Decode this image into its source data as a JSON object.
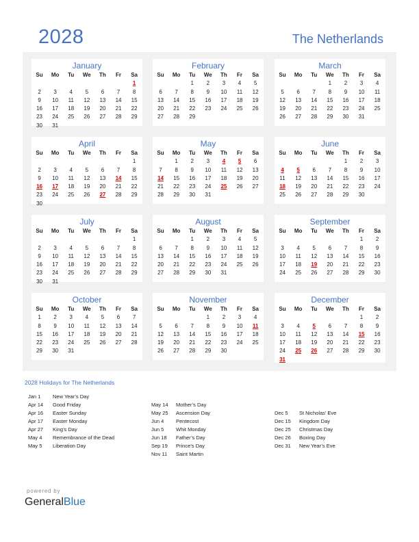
{
  "header": {
    "year": "2028",
    "country": "The Netherlands"
  },
  "weekdays": [
    "Su",
    "Mo",
    "Tu",
    "We",
    "Th",
    "Fr",
    "Sa"
  ],
  "months": [
    {
      "name": "January",
      "start": 6,
      "days": 31,
      "holidays": [
        1
      ]
    },
    {
      "name": "February",
      "start": 2,
      "days": 29,
      "holidays": []
    },
    {
      "name": "March",
      "start": 3,
      "days": 31,
      "holidays": []
    },
    {
      "name": "April",
      "start": 6,
      "days": 30,
      "holidays": [
        14,
        16,
        17,
        27
      ]
    },
    {
      "name": "May",
      "start": 1,
      "days": 31,
      "holidays": [
        4,
        5,
        14,
        25
      ]
    },
    {
      "name": "June",
      "start": 4,
      "days": 30,
      "holidays": [
        4,
        5,
        18
      ]
    },
    {
      "name": "July",
      "start": 6,
      "days": 31,
      "holidays": []
    },
    {
      "name": "August",
      "start": 2,
      "days": 31,
      "holidays": []
    },
    {
      "name": "September",
      "start": 5,
      "days": 30,
      "holidays": [
        19
      ]
    },
    {
      "name": "October",
      "start": 0,
      "days": 31,
      "holidays": []
    },
    {
      "name": "November",
      "start": 3,
      "days": 30,
      "holidays": [
        11
      ]
    },
    {
      "name": "December",
      "start": 5,
      "days": 31,
      "holidays": [
        5,
        15,
        25,
        26,
        31
      ]
    }
  ],
  "holidays_title": "2028 Holidays for The Netherlands",
  "holiday_columns": [
    [
      {
        "date": "Jan 1",
        "name": "New Year’s Day"
      },
      {
        "date": "Apr 14",
        "name": "Good Friday"
      },
      {
        "date": "Apr 16",
        "name": "Easter Sunday"
      },
      {
        "date": "Apr 17",
        "name": "Easter Monday"
      },
      {
        "date": "Apr 27",
        "name": "King’s Day"
      },
      {
        "date": "May 4",
        "name": "Remembrance of the Dead"
      },
      {
        "date": "May 5",
        "name": "Liberation Day"
      }
    ],
    [
      {
        "date": "May 14",
        "name": "Mother’s Day"
      },
      {
        "date": "May 25",
        "name": "Ascension Day"
      },
      {
        "date": "Jun 4",
        "name": "Pentecost"
      },
      {
        "date": "Jun 5",
        "name": "Whit Monday"
      },
      {
        "date": "Jun 18",
        "name": "Father’s Day"
      },
      {
        "date": "Sep 19",
        "name": "Prince’s Day"
      },
      {
        "date": "Nov 11",
        "name": "Saint Martin"
      }
    ],
    [
      {
        "date": "Dec 5",
        "name": "St Nicholas’ Eve"
      },
      {
        "date": "Dec 15",
        "name": "Kingdom Day"
      },
      {
        "date": "Dec 25",
        "name": "Christmas Day"
      },
      {
        "date": "Dec 26",
        "name": "Boxing Day"
      },
      {
        "date": "Dec 31",
        "name": "New Year’s Eve"
      }
    ]
  ],
  "footer": {
    "powered_by": "powered by",
    "brand_general": "General",
    "brand_blue": "Blue"
  }
}
